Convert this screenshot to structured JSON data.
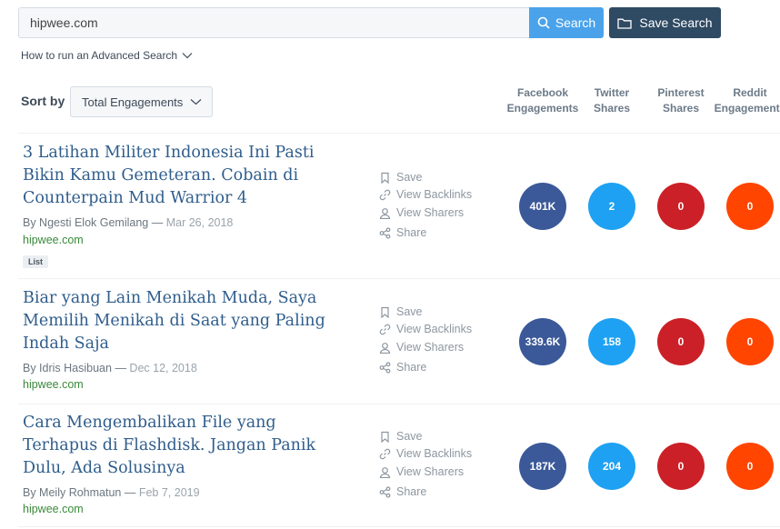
{
  "search": {
    "value": "hipwee.com",
    "button_label": "Search",
    "save_label": "Save Search"
  },
  "advanced_link": "How to run an Advanced Search",
  "sort": {
    "label": "Sort by",
    "selected": "Total Engagements"
  },
  "columns": [
    {
      "line1": "Facebook",
      "line2": "Engagements"
    },
    {
      "line1": "Twitter",
      "line2": "Shares"
    },
    {
      "line1": "Pinterest",
      "line2": "Shares"
    },
    {
      "line1": "Reddit",
      "line2": "Engagements"
    }
  ],
  "actions": {
    "save": "Save",
    "backlinks": "View Backlinks",
    "sharers": "View Sharers",
    "share": "Share"
  },
  "colors": {
    "facebook": "#3b5998",
    "twitter": "#1da1f2",
    "pinterest": "#cb2027",
    "reddit": "#ff4500"
  },
  "results": [
    {
      "title": "3 Latihan Militer Indonesia Ini Pasti Bikin Kamu Gemeteran. Cobain di Counterpain Mud Warrior 4",
      "author": "By Ngesti Elok Gemilang",
      "date": "Mar 26, 2018",
      "domain": "hipwee.com",
      "tag": "List",
      "facebook": "401K",
      "twitter": "2",
      "pinterest": "0",
      "reddit": "0"
    },
    {
      "title": "Biar yang Lain Menikah Muda, Saya Memilih Menikah di Saat yang Paling Indah Saja",
      "author": "By Idris Hasibuan",
      "date": "Dec 12, 2018",
      "domain": "hipwee.com",
      "facebook": "339.6K",
      "twitter": "158",
      "pinterest": "0",
      "reddit": "0"
    },
    {
      "title": "Cara Mengembalikan File yang Terhapus di Flashdisk. Jangan Panik Dulu, Ada Solusinya",
      "author": "By Meily Rohmatun",
      "date": "Feb 7, 2019",
      "domain": "hipwee.com",
      "facebook": "187K",
      "twitter": "204",
      "pinterest": "0",
      "reddit": "0"
    }
  ]
}
